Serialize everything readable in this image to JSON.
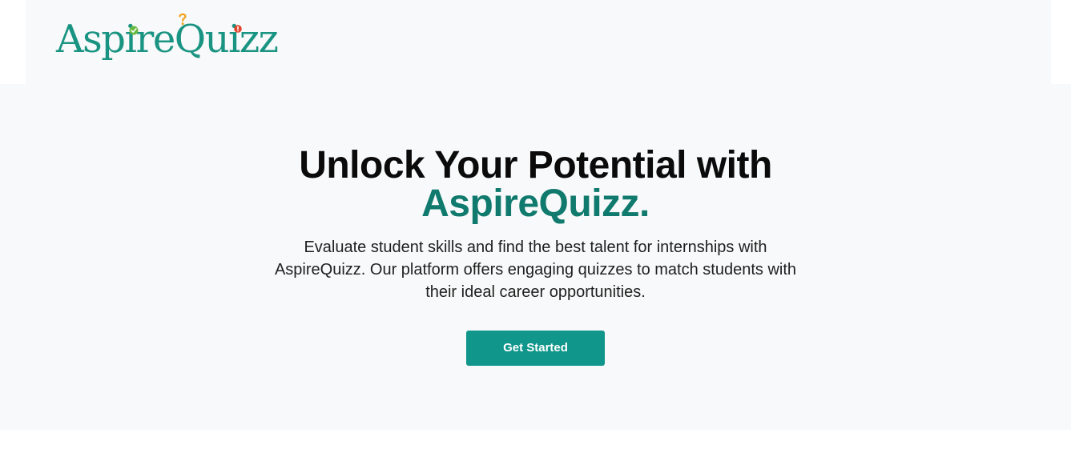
{
  "brand": {
    "logo_text": "AspireQuizz",
    "logo_color": "#1a9482",
    "logo_accents": [
      "check-icon",
      "question-icon",
      "exclamation-icon"
    ]
  },
  "hero": {
    "headline_line1": "Unlock Your Potential with",
    "headline_brand": "AspireQuizz.",
    "description": "Evaluate student skills and find the best talent for internships with AspireQuizz. Our platform offers engaging quizzes to match students with their ideal career opportunities.",
    "cta_label": "Get Started",
    "brand_color": "#0f7a6d",
    "cta_color": "#10968a",
    "background_color": "#f8f9fa"
  }
}
